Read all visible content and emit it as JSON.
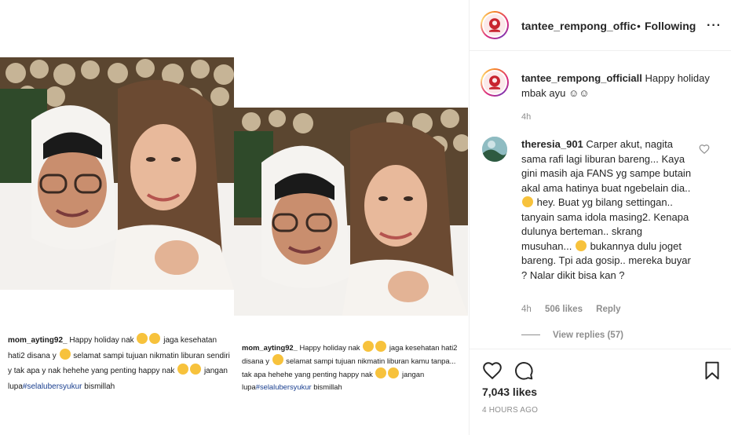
{
  "media": {
    "caption_top": {
      "user": "mom_ayting92_",
      "text_a": "Happy holiday nak",
      "text_b": "jaga kesehatan  hati2 disana y",
      "text_c": "selamat sampi tujuan nikmatin liburan sendiri y tak apa y nak hehehe yang penting happy  nak",
      "text_d": "jangan lupa",
      "hashtag": "#selalubersyukur",
      "text_e": "bismillah"
    },
    "caption_bottom": {
      "user": "mom_ayting92_",
      "text_a": "Happy holiday nak",
      "text_b": "jaga kesehatan hati2 disana y",
      "text_c": "selamat sampi tujuan nikmatin liburan kamu tanpa... tak apa hehehe yang penting happy  nak",
      "text_d": "jangan lupa",
      "hashtag": "#selalubersyukur",
      "text_e": "bismillah"
    }
  },
  "header": {
    "username": "tantee_rempong_official",
    "separator": "•",
    "follow_state": "Following",
    "more_icon": "···"
  },
  "caption": {
    "username": "tantee_rempong_officiall",
    "text": "Happy holiday mbak ayu ☺☺",
    "time": "4h"
  },
  "comment": {
    "username": "theresia_901",
    "text_1": "Carper akut, nagita sama rafi lagi liburan bareng... Kaya gini masih aja FANS yg sampe butain akal ama hatinya buat ngebelain dia..",
    "text_2": "hey. Buat yg bilang settingan.. tanyain sama idola masing2. Kenapa dulunya berteman.. skrang musuhan...",
    "text_3": "bukannya dulu joget bareng. Tpi ada gosip.. mereka buyar ? Nalar dikit bisa kan ?",
    "time": "4h",
    "likes": "506 likes",
    "reply": "Reply",
    "view_replies": "View replies (57)"
  },
  "actions": {
    "likes": "7,043 likes",
    "timeago": "4 HOURS AGO"
  },
  "colors": {
    "text": "#262626",
    "muted": "#8e8e8e",
    "border": "#efefef",
    "hashtag": "#1a3f8f"
  },
  "icons": [
    "heart-icon",
    "comment-icon",
    "bookmark-icon",
    "more-icon",
    "heart-small-icon"
  ]
}
